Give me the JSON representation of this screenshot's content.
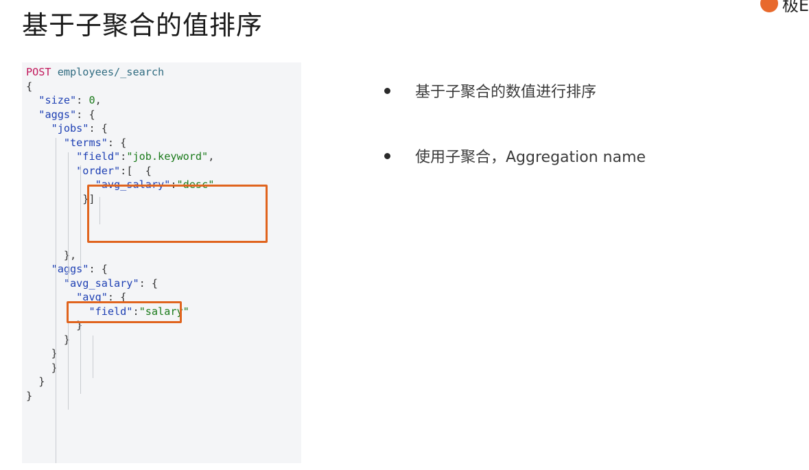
{
  "slide": {
    "title": "基于子聚合的值排序",
    "logo_text": "极E"
  },
  "code": {
    "lines": [
      [
        {
          "t": "POST",
          "c": "method"
        },
        {
          "t": " employees/_search",
          "c": "path"
        }
      ],
      [
        {
          "t": "{",
          "c": "punc"
        }
      ],
      [
        {
          "t": "  ",
          "c": "punc"
        },
        {
          "t": "\"size\"",
          "c": "key"
        },
        {
          "t": ": ",
          "c": "punc"
        },
        {
          "t": "0",
          "c": "num"
        },
        {
          "t": ",",
          "c": "punc"
        }
      ],
      [
        {
          "t": "  ",
          "c": "punc"
        },
        {
          "t": "\"aggs\"",
          "c": "key"
        },
        {
          "t": ": {",
          "c": "punc"
        }
      ],
      [
        {
          "t": "    ",
          "c": "punc"
        },
        {
          "t": "\"jobs\"",
          "c": "key"
        },
        {
          "t": ": {",
          "c": "punc"
        }
      ],
      [
        {
          "t": "      ",
          "c": "punc"
        },
        {
          "t": "\"terms\"",
          "c": "key"
        },
        {
          "t": ": {",
          "c": "punc"
        }
      ],
      [
        {
          "t": "        ",
          "c": "punc"
        },
        {
          "t": "\"field\"",
          "c": "key"
        },
        {
          "t": ":",
          "c": "punc"
        },
        {
          "t": "\"job.keyword\"",
          "c": "str"
        },
        {
          "t": ",",
          "c": "punc"
        }
      ],
      [
        {
          "t": "        ",
          "c": "punc"
        },
        {
          "t": "\"order\"",
          "c": "key"
        },
        {
          "t": ":[  {",
          "c": "punc"
        }
      ],
      [
        {
          "t": "           ",
          "c": "punc"
        },
        {
          "t": "\"avg_salary\"",
          "c": "key"
        },
        {
          "t": ":",
          "c": "punc"
        },
        {
          "t": "\"desc\"",
          "c": "str"
        }
      ],
      [
        {
          "t": "         }]",
          "c": "punc"
        }
      ],
      [],
      [],
      [],
      [
        {
          "t": "      },",
          "c": "punc"
        }
      ],
      [
        {
          "t": "    ",
          "c": "punc"
        },
        {
          "t": "\"aggs\"",
          "c": "key"
        },
        {
          "t": ": {",
          "c": "punc"
        }
      ],
      [
        {
          "t": "      ",
          "c": "punc"
        },
        {
          "t": "\"avg_salary\"",
          "c": "key"
        },
        {
          "t": ": {",
          "c": "punc"
        }
      ],
      [
        {
          "t": "        ",
          "c": "punc"
        },
        {
          "t": "\"avg\"",
          "c": "key"
        },
        {
          "t": ": {",
          "c": "punc"
        }
      ],
      [
        {
          "t": "          ",
          "c": "punc"
        },
        {
          "t": "\"field\"",
          "c": "key"
        },
        {
          "t": ":",
          "c": "punc"
        },
        {
          "t": "\"salary\"",
          "c": "str"
        }
      ],
      [
        {
          "t": "        }",
          "c": "punc"
        }
      ],
      [
        {
          "t": "      }",
          "c": "punc"
        }
      ],
      [
        {
          "t": "    }",
          "c": "punc"
        }
      ],
      [
        {
          "t": "    }",
          "c": "punc"
        }
      ],
      [
        {
          "t": "  }",
          "c": "punc"
        }
      ],
      [
        {
          "t": "}",
          "c": "punc"
        }
      ]
    ]
  },
  "bullets": [
    {
      "text": "基于子聚合的数值进行排序"
    },
    {
      "text": "使用子聚合，Aggregation name"
    }
  ],
  "colors": {
    "accent": "#e0641e",
    "method": "#c2185b",
    "key": "#1d3fb3",
    "string": "#1a7a1a"
  }
}
